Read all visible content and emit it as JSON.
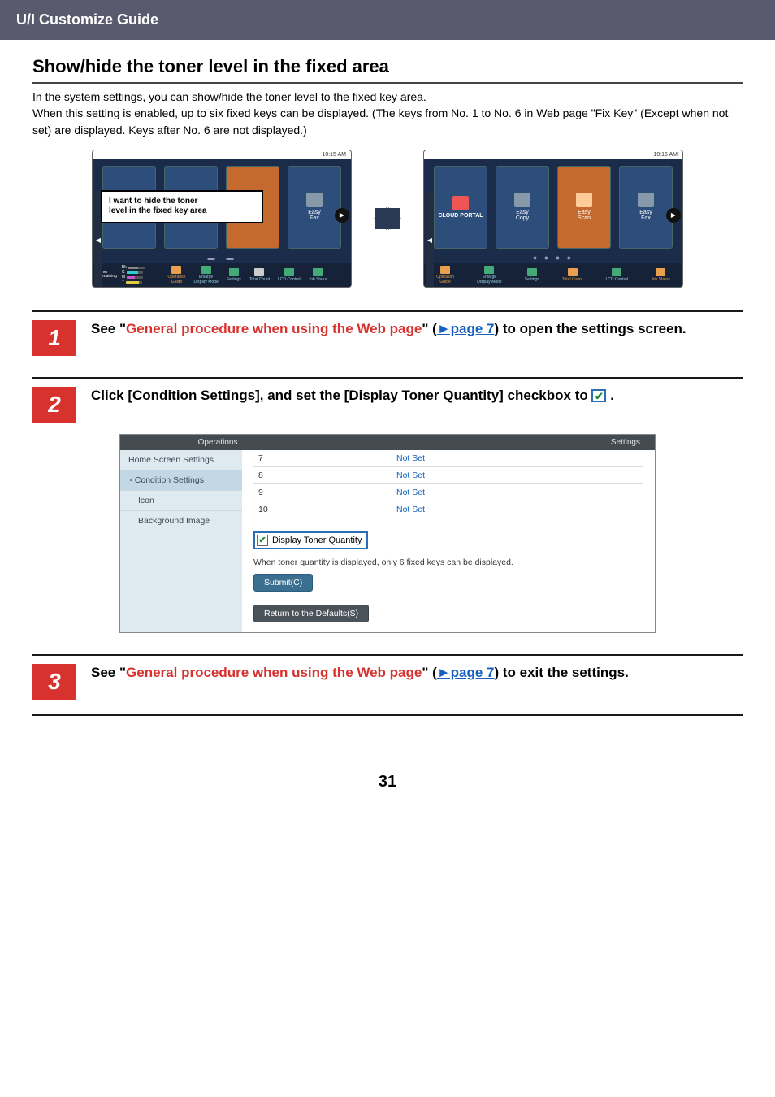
{
  "header": {
    "title": "U/I Customize Guide"
  },
  "section": {
    "heading": "Show/hide the toner level in the fixed area"
  },
  "intro": "In the system settings, you can show/hide the toner level to the fixed key area.\nWhen this setting is enabled, up to six fixed keys can be displayed. (The keys from No. 1 to No. 6 in Web page \"Fix Key\" (Except when not set) are displayed.  Keys after No. 6 are not displayed.)",
  "figure": {
    "clock": "10:15 AM",
    "callout_l1": "I want to hide the toner",
    "callout_l2": "level in the fixed key area",
    "tile_cloud": "CLOUD PORTAL",
    "tile_copy": "Easy\nCopy",
    "tile_scan": "Easy\nScan",
    "tile_fax": "Easy\nFax",
    "toner_label": "Toner\nRemaining",
    "toner_bk": "Bk",
    "toner_c": "C",
    "toner_m": "M",
    "toner_y": "Y",
    "bot_guide": "Operation\nGuide",
    "bot_enlarge": "Enlarge\nDisplay Mode",
    "bot_settings": "Settings",
    "bot_total": "Total Count",
    "bot_lcd": "LCD Control",
    "bot_job": "Job Status"
  },
  "steps": {
    "s1_pre": "See \"",
    "s1_link": "General procedure when using the Web page",
    "s1_mid": "\" (",
    "s1_page": "►page 7",
    "s1_post": ") to open the settings screen.",
    "s2_main": "Click [Condition Settings], and set the [Display Toner Quantity] checkbox to ",
    "s2_end": " .",
    "s3_pre": "See \"",
    "s3_link": "General procedure when using the Web page",
    "s3_mid": "\" (",
    "s3_page": "►page 7",
    "s3_post": ") to exit the settings."
  },
  "settings": {
    "tab_ops": "Operations",
    "tab_sys": "Settings",
    "side_home": "Home Screen Settings",
    "side_cond": "Condition Settings",
    "side_icon": "Icon",
    "side_bg": "Background Image",
    "rows": [
      {
        "n": "7",
        "v": "Not Set"
      },
      {
        "n": "8",
        "v": "Not Set"
      },
      {
        "n": "9",
        "v": "Not Set"
      },
      {
        "n": "10",
        "v": "Not Set"
      }
    ],
    "checkbox_label": "Display Toner Quantity",
    "hint": "When toner quantity is displayed, only 6 fixed keys can be displayed.",
    "submit": "Submit(C)",
    "defaults": "Return to the Defaults(S)"
  },
  "page_number": "31"
}
